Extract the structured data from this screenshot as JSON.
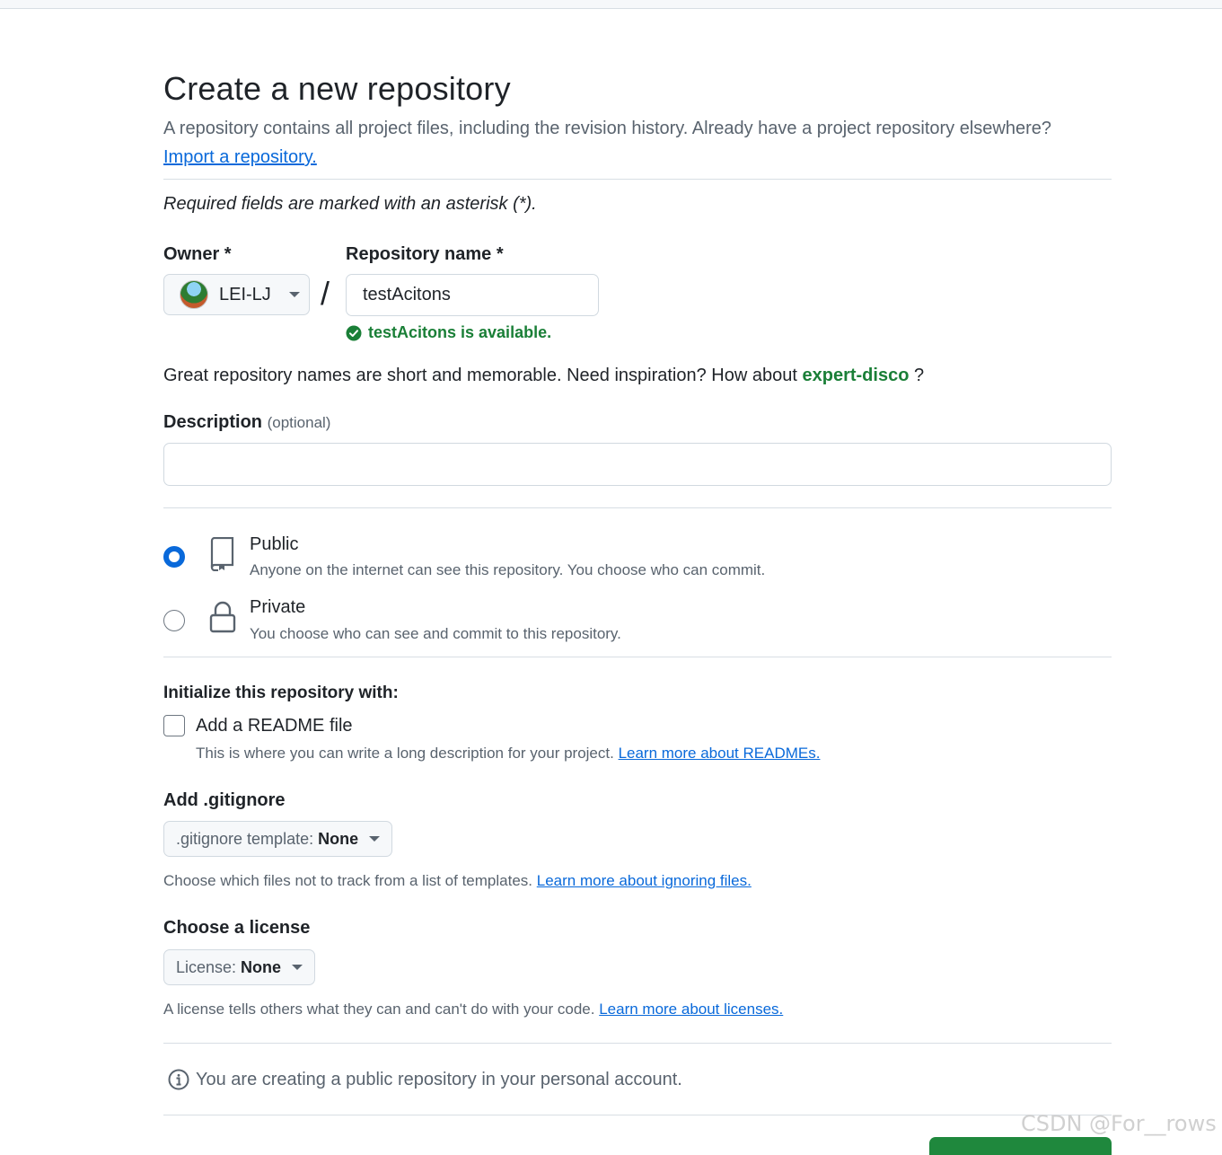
{
  "page": {
    "title": "Create a new repository",
    "subtitle": "A repository contains all project files, including the revision history. Already have a project repository elsewhere?",
    "import_link": "Import a repository.",
    "required_note": "Required fields are marked with an asterisk (*)."
  },
  "owner": {
    "label": "Owner *",
    "value": "LEI-LJ"
  },
  "repo": {
    "label": "Repository name *",
    "value": "testAcitons",
    "availability": "testAcitons is available."
  },
  "suggestion": {
    "text": "Great repository names are short and memorable. Need inspiration? How about",
    "name": "expert-disco",
    "suffix": " ?"
  },
  "description": {
    "label": "Description",
    "optional": "(optional)",
    "value": ""
  },
  "visibility": {
    "public": {
      "title": "Public",
      "desc": "Anyone on the internet can see this repository. You choose who can commit.",
      "checked": true
    },
    "private": {
      "title": "Private",
      "desc": "You choose who can see and commit to this repository.",
      "checked": false
    }
  },
  "init": {
    "heading": "Initialize this repository with:",
    "readme_label": "Add a README file",
    "readme_desc": "This is where you can write a long description for your project.",
    "readme_link": "Learn more about READMEs.",
    "readme_checked": false
  },
  "gitignore": {
    "heading": "Add .gitignore",
    "key": ".gitignore template:",
    "value": "None",
    "hint": "Choose which files not to track from a list of templates.",
    "link": "Learn more about ignoring files."
  },
  "license": {
    "heading": "Choose a license",
    "key": "License:",
    "value": "None",
    "hint": "A license tells others what they can and can't do with your code.",
    "link": "Learn more about licenses."
  },
  "notice": {
    "text": "You are creating a public repository in your personal account."
  },
  "watermark": "CSDN @For__rows",
  "colors": {
    "link": "#0969da",
    "success": "#1a7f37",
    "primary_button": "#1f883d",
    "radio_checked": "#0969da"
  },
  "icons": [
    "check-circle-icon",
    "repo-icon",
    "lock-icon",
    "info-icon",
    "caret-down-icon"
  ]
}
